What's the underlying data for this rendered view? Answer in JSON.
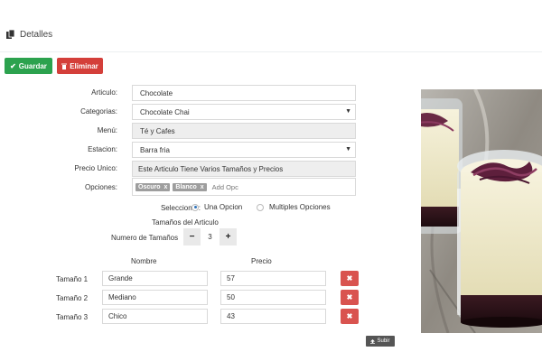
{
  "header": {
    "title": "Detalles"
  },
  "toolbar": {
    "save_label": "Guardar",
    "delete_label": "Eliminar"
  },
  "form": {
    "articulo": {
      "label": "Articulo:",
      "value": "Chocolate"
    },
    "categorias": {
      "label": "Categorias:",
      "value": "Chocolate Chai"
    },
    "menu": {
      "label": "Menú:",
      "value": "Té y Cafes"
    },
    "estacion": {
      "label": "Estacion:",
      "value": "Barra fria"
    },
    "precio_unico": {
      "label": "Precio Unico:",
      "value": "Este Articulo Tiene Varios Tamaños y Precios"
    },
    "opciones": {
      "label": "Opciones:",
      "tags": [
        "Oscuro",
        "Blanco"
      ],
      "placeholder": "Add Opc"
    },
    "seleccionar": {
      "label": "Seleccionar:",
      "option1": "Una Opcion",
      "option2": "Multiples Opciones",
      "selected": "Una Opcion"
    },
    "tamanos_title": "Tamaños del Articulo",
    "numero_label": "Numero de Tamaños",
    "numero_value": "3"
  },
  "sizes": {
    "col_nombre": "Nombre",
    "col_precio": "Precio",
    "rows": [
      {
        "label": "Tamaño 1",
        "nombre": "Grande",
        "precio": "57"
      },
      {
        "label": "Tamaño 2",
        "nombre": "Mediano",
        "precio": "50"
      },
      {
        "label": "Tamaño 3",
        "nombre": "Chico",
        "precio": "43"
      }
    ]
  },
  "upload_label": "Subir",
  "colors": {
    "save": "#2ca24e",
    "delete": "#d43f3a",
    "remove": "#d9534f",
    "upload": "#555555"
  }
}
